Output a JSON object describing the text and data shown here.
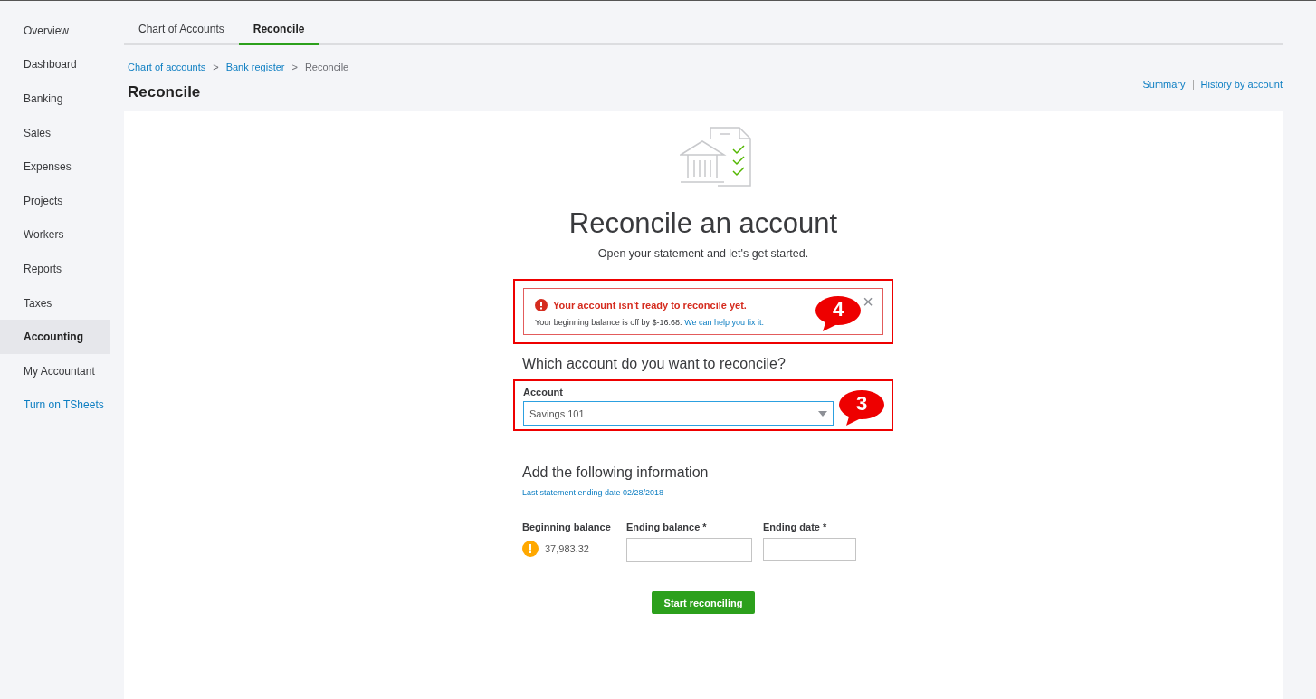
{
  "sidebar": {
    "items": [
      {
        "label": "Overview",
        "selected": false,
        "kind": "nav"
      },
      {
        "label": "Dashboard",
        "selected": false,
        "kind": "nav"
      },
      {
        "label": "Banking",
        "selected": false,
        "kind": "nav"
      },
      {
        "label": "Sales",
        "selected": false,
        "kind": "nav"
      },
      {
        "label": "Expenses",
        "selected": false,
        "kind": "nav"
      },
      {
        "label": "Projects",
        "selected": false,
        "kind": "nav"
      },
      {
        "label": "Workers",
        "selected": false,
        "kind": "nav"
      },
      {
        "label": "Reports",
        "selected": false,
        "kind": "nav"
      },
      {
        "label": "Taxes",
        "selected": false,
        "kind": "nav"
      },
      {
        "label": "Accounting",
        "selected": true,
        "kind": "nav"
      },
      {
        "label": "My Accountant",
        "selected": false,
        "kind": "nav"
      },
      {
        "label": "Turn on TSheets",
        "selected": false,
        "kind": "link"
      }
    ]
  },
  "tabs": [
    {
      "label": "Chart of Accounts",
      "selected": false
    },
    {
      "label": "Reconcile",
      "selected": true
    }
  ],
  "breadcrumb": [
    {
      "label": "Chart of accounts",
      "kind": "link"
    },
    {
      "label": "Bank register",
      "kind": "link"
    },
    {
      "label": "Reconcile",
      "kind": "current"
    }
  ],
  "breadcrumb_separator": ">",
  "page_title": "Reconcile",
  "header_links": [
    "Summary",
    "History by account"
  ],
  "card": {
    "title": "Reconcile an account",
    "subtitle": "Open your statement and let's get started.",
    "alert": {
      "title": "Your account isn't ready to reconcile yet.",
      "message": "Your beginning balance is off by $-16.68.",
      "link": "We can help you fix it.",
      "close": "×",
      "callout": "4"
    },
    "account_question": "Which account do you want to reconcile?",
    "account_field": {
      "label": "Account",
      "value": "Savings 101",
      "callout": "3"
    },
    "info_heading": "Add the following information",
    "last_statement": "Last statement ending date 02/28/2018",
    "beginning_balance": {
      "label": "Beginning balance",
      "value": "37,983.32",
      "warning": true
    },
    "ending_balance": {
      "label": "Ending balance *"
    },
    "ending_date": {
      "label": "Ending date *"
    },
    "button": "Start reconciling"
  }
}
